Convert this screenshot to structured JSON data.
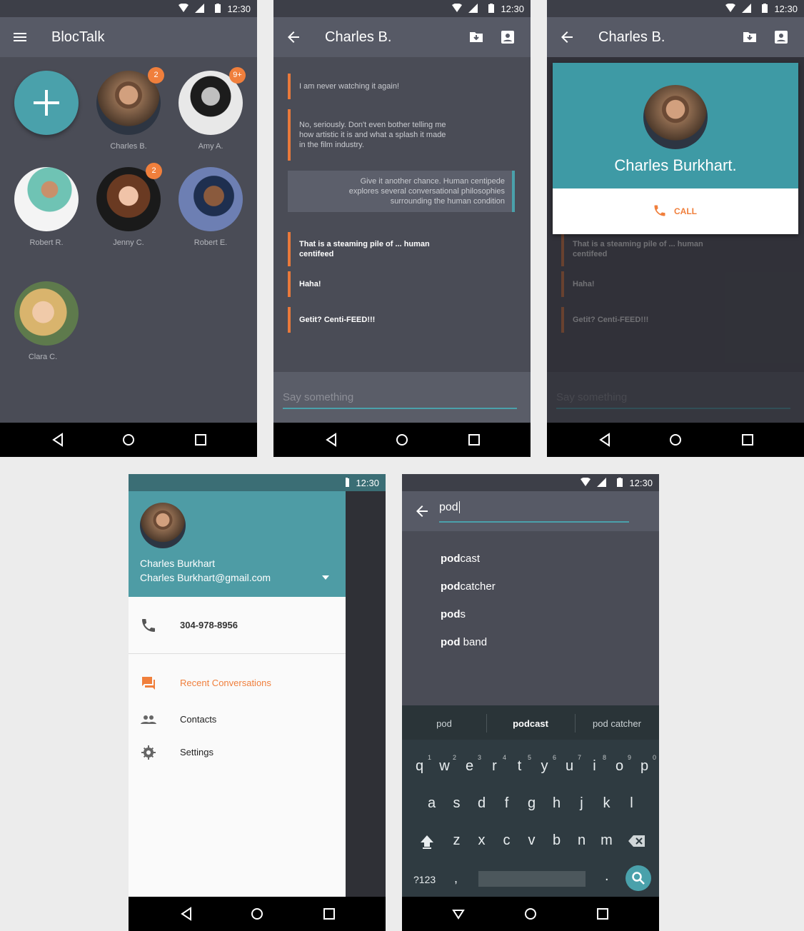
{
  "status": {
    "time": "12:30"
  },
  "screen1": {
    "app_title": "BlocTalk",
    "add_label": "+",
    "contacts": [
      {
        "name": "Charles B.",
        "badge": "2"
      },
      {
        "name": "Amy A.",
        "badge": "9+"
      },
      {
        "name": "Robert R.",
        "badge": ""
      },
      {
        "name": "Jenny C.",
        "badge": "2"
      },
      {
        "name": "Robert E.",
        "badge": ""
      },
      {
        "name": "Clara C.",
        "badge": ""
      }
    ]
  },
  "conversation": {
    "title": "Charles B.",
    "messages": [
      {
        "text": "I am never watching it again!",
        "style": "incoming"
      },
      {
        "text": "No, seriously. Don't even bother telling me how artistic it is and what a splash it made in the film industry.",
        "style": "incoming"
      },
      {
        "text": "Give it another chance. Human centipede explores several conversational philosophies surrounding the human condition",
        "style": "outgoing"
      },
      {
        "text": "That is a steaming pile of ... human centifeed",
        "style": "bold"
      },
      {
        "text": "Haha!",
        "style": "bold"
      },
      {
        "text": "Getit? Centi-FEED!!!",
        "style": "bold"
      }
    ],
    "input_placeholder": "Say something"
  },
  "profile": {
    "title": "Charles B.",
    "name": "Charles Burkhart.",
    "call_label": "CALL"
  },
  "drawer": {
    "user_name": "Charles Burkhart",
    "user_email": "Charles Burkhart@gmail.com",
    "phone": "304-978-8956",
    "items": [
      {
        "label": "Recent Conversations",
        "active": true,
        "icon": "forum-icon"
      },
      {
        "label": "Contacts",
        "active": false,
        "icon": "people-icon"
      },
      {
        "label": "Settings",
        "active": false,
        "icon": "gear-icon"
      }
    ]
  },
  "search": {
    "query": "pod",
    "suggestions": [
      {
        "bold": "pod",
        "rest": "cast"
      },
      {
        "bold": "pod",
        "rest": "catcher"
      },
      {
        "bold": "pod",
        "rest": "s"
      },
      {
        "bold": "pod",
        "rest": " band"
      }
    ],
    "keyboard_suggestions": [
      "pod",
      "podcast",
      "pod catcher"
    ],
    "row1": [
      "q",
      "w",
      "e",
      "r",
      "t",
      "y",
      "u",
      "i",
      "o",
      "p"
    ],
    "row1_nums": [
      "1",
      "2",
      "3",
      "4",
      "5",
      "6",
      "7",
      "8",
      "9",
      "0"
    ],
    "row2": [
      "a",
      "s",
      "d",
      "f",
      "g",
      "h",
      "j",
      "k",
      "l"
    ],
    "row3": [
      "z",
      "x",
      "c",
      "v",
      "b",
      "n",
      "m"
    ],
    "symbols_key": "?123",
    "comma_key": ",",
    "period_key": "."
  },
  "colors": {
    "accent": "#4aa1ab",
    "orange": "#f07f3c",
    "bg": "#4a4c56"
  }
}
